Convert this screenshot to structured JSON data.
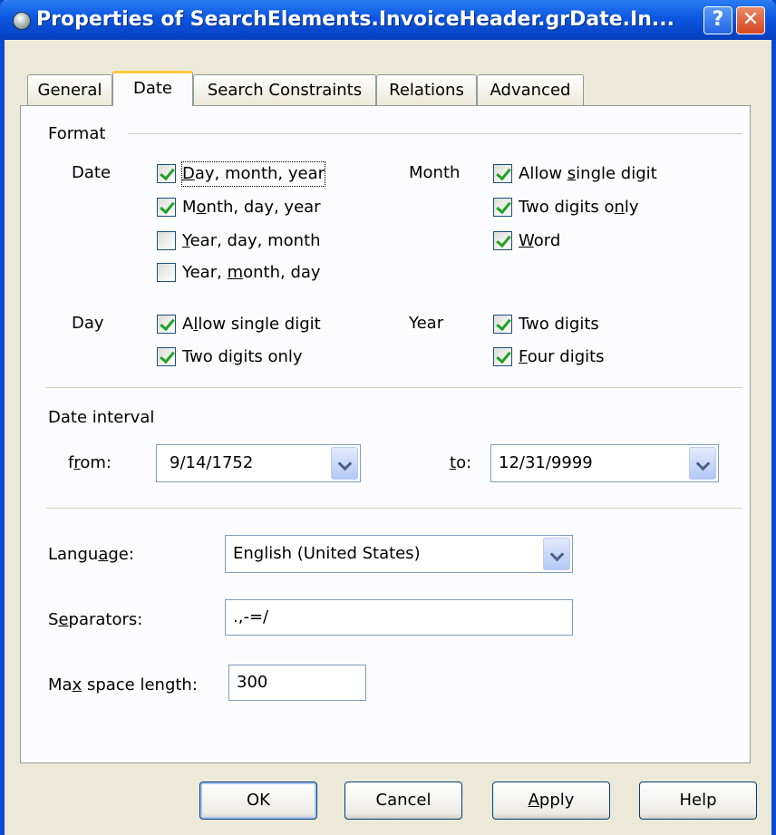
{
  "window": {
    "title": "Properties of SearchElements.InvoiceHeader.grDate.In...",
    "help_label": "?",
    "close_label": "✕"
  },
  "tabs": [
    {
      "label": "General",
      "active": false
    },
    {
      "label": "Date",
      "active": true
    },
    {
      "label": "Search Constraints",
      "active": false
    },
    {
      "label": "Relations",
      "active": false
    },
    {
      "label": "Advanced",
      "active": false
    }
  ],
  "format": {
    "heading": "Format",
    "date": {
      "label": "Date",
      "options": [
        {
          "pre": "",
          "u": "D",
          "post": "ay, month, year",
          "checked": true
        },
        {
          "pre": "M",
          "u": "o",
          "post": "nth, day, year",
          "checked": true
        },
        {
          "pre": "",
          "u": "Y",
          "post": "ear, day, month",
          "checked": false
        },
        {
          "pre": "Year, ",
          "u": "m",
          "post": "onth, day",
          "checked": false
        }
      ]
    },
    "month": {
      "label": "Month",
      "options": [
        {
          "pre": "Allow ",
          "u": "s",
          "post": "ingle digit",
          "checked": true
        },
        {
          "pre": "Two digits o",
          "u": "n",
          "post": "ly",
          "checked": true
        },
        {
          "pre": "",
          "u": "W",
          "post": "ord",
          "checked": true
        }
      ]
    },
    "day": {
      "label": "Day",
      "options": [
        {
          "pre": "A",
          "u": "l",
          "post": "low single digit",
          "checked": true
        },
        {
          "pre": "Two di",
          "u": "g",
          "post": "its only",
          "checked": true
        }
      ]
    },
    "year": {
      "label": "Year",
      "options": [
        {
          "pre": "Two digits",
          "u": "",
          "post": "",
          "checked": true
        },
        {
          "pre": "",
          "u": "F",
          "post": "our digits",
          "checked": true
        }
      ]
    }
  },
  "date_interval": {
    "heading": "Date interval",
    "from_pre": "f",
    "from_u": "r",
    "from_post": "om:",
    "from_value": "9/14/1752",
    "to_pre": "",
    "to_u": "t",
    "to_post": "o:",
    "to_value": "12/31/9999"
  },
  "language": {
    "pre": "Langu",
    "u": "a",
    "post": "ge:",
    "value": "English (United States)"
  },
  "separators": {
    "pre": "S",
    "u": "e",
    "post": "parators:",
    "value": ".,-=/"
  },
  "max_space": {
    "pre": "Ma",
    "u": "x",
    "post": " space length:",
    "value": "300"
  },
  "buttons": {
    "ok": "OK",
    "cancel": "Cancel",
    "apply_u": "A",
    "apply_post": "pply",
    "help": "Help"
  }
}
